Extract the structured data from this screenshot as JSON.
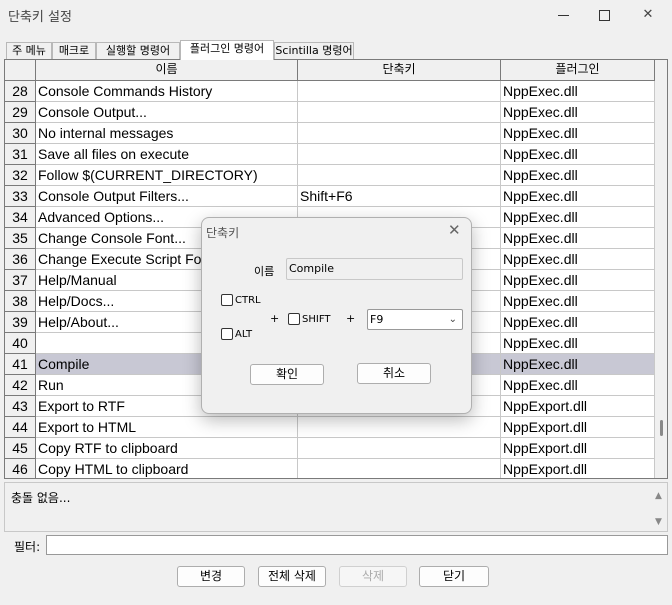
{
  "window": {
    "title": "단축키 설정"
  },
  "tabs": [
    {
      "label": "주 메뉴"
    },
    {
      "label": "매크로"
    },
    {
      "label": "실행할 명령어"
    },
    {
      "label": "플러그인 명령어"
    },
    {
      "label": "Scintilla 명령어"
    }
  ],
  "table": {
    "headers": {
      "name": "이름",
      "shortcut": "단축키",
      "plugin": "플러그인"
    },
    "rows": [
      {
        "num": "28",
        "name": "Console Commands History",
        "shortcut": "",
        "plugin": "NppExec.dll"
      },
      {
        "num": "29",
        "name": "Console Output...",
        "shortcut": "",
        "plugin": "NppExec.dll"
      },
      {
        "num": "30",
        "name": "No internal messages",
        "shortcut": "",
        "plugin": "NppExec.dll"
      },
      {
        "num": "31",
        "name": "Save all files on execute",
        "shortcut": "",
        "plugin": "NppExec.dll"
      },
      {
        "num": "32",
        "name": "Follow $(CURRENT_DIRECTORY)",
        "shortcut": "",
        "plugin": "NppExec.dll"
      },
      {
        "num": "33",
        "name": "Console Output Filters...",
        "shortcut": "Shift+F6",
        "plugin": "NppExec.dll"
      },
      {
        "num": "34",
        "name": "Advanced Options...",
        "shortcut": "",
        "plugin": "NppExec.dll"
      },
      {
        "num": "35",
        "name": "Change Console Font...",
        "shortcut": "",
        "plugin": "NppExec.dll"
      },
      {
        "num": "36",
        "name": "Change Execute Script Font...",
        "shortcut": "",
        "plugin": "NppExec.dll"
      },
      {
        "num": "37",
        "name": "Help/Manual",
        "shortcut": "",
        "plugin": "NppExec.dll"
      },
      {
        "num": "38",
        "name": "Help/Docs...",
        "shortcut": "",
        "plugin": "NppExec.dll"
      },
      {
        "num": "39",
        "name": "Help/About...",
        "shortcut": "",
        "plugin": "NppExec.dll"
      },
      {
        "num": "40",
        "name": "",
        "shortcut": "",
        "plugin": "NppExec.dll"
      },
      {
        "num": "41",
        "name": "Compile",
        "shortcut": "",
        "plugin": "NppExec.dll",
        "selected": true
      },
      {
        "num": "42",
        "name": "Run",
        "shortcut": "",
        "plugin": "NppExec.dll"
      },
      {
        "num": "43",
        "name": "Export to RTF",
        "shortcut": "",
        "plugin": "NppExport.dll"
      },
      {
        "num": "44",
        "name": "Export to HTML",
        "shortcut": "",
        "plugin": "NppExport.dll"
      },
      {
        "num": "45",
        "name": "Copy RTF to clipboard",
        "shortcut": "",
        "plugin": "NppExport.dll"
      },
      {
        "num": "46",
        "name": "Copy HTML to clipboard",
        "shortcut": "",
        "plugin": "NppExport.dll"
      }
    ]
  },
  "conflict": {
    "message": "충돌 없음..."
  },
  "filter": {
    "label": "필터:",
    "value": ""
  },
  "buttons": {
    "modify": "변경",
    "clear": "전체 삭제",
    "delete": "삭제",
    "close": "닫기"
  },
  "dialog": {
    "title": "단축키",
    "name_label": "이름",
    "name_value": "Compile",
    "ctrl_label": "CTRL",
    "alt_label": "ALT",
    "shift_label": "SHIFT",
    "plus": "+",
    "key": "F9",
    "ok": "확인",
    "cancel": "취소"
  }
}
